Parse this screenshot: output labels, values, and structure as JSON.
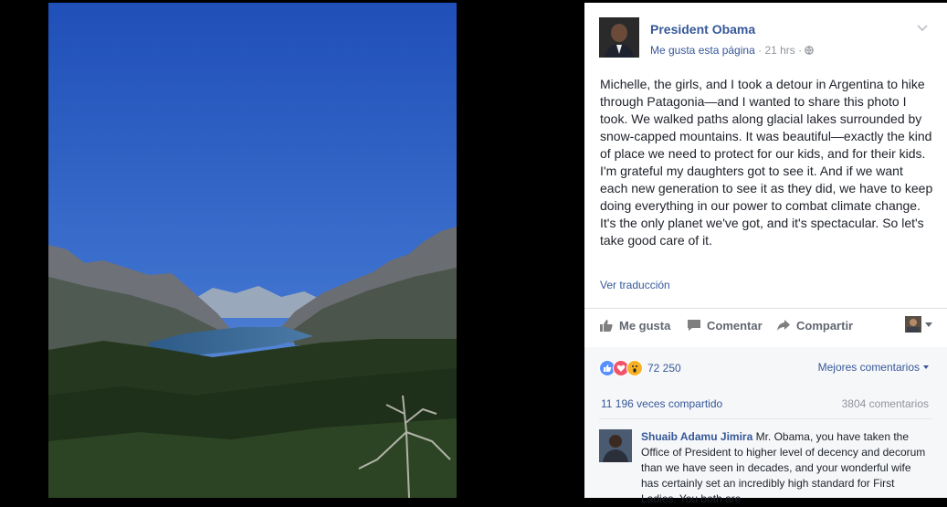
{
  "page": {
    "name": "President Obama",
    "like_page": "Me gusta esta página",
    "dot": "·",
    "time": "21 hrs",
    "dot2": "·"
  },
  "post": {
    "text": "Michelle, the girls, and I took a detour in Argentina to hike through Patagonia—and I wanted to share this photo I took. We walked paths along glacial lakes surrounded by snow-capped mountains. It was beautiful—exactly the kind of place we need to protect for our kids, and for their kids. I'm grateful my daughters got to see it. And if we want each new generation to see it as they did, we have to keep doing everything in our power to combat climate change. It's the only planet we've got, and it's spectacular. So let's take good care of it.",
    "see_translation": "Ver traducción"
  },
  "actions": {
    "like": "Me gusta",
    "comment": "Comentar",
    "share": "Compartir"
  },
  "stats": {
    "reaction_count": "72 250",
    "best_comments": "Mejores comentarios",
    "shares": "11 196 veces compartido",
    "comments": "3804 comentarios"
  },
  "comment": {
    "author": "Shuaib Adamu Jimira",
    "text": "Mr. Obama, you have taken the Office of President to higher level of decency and decorum than we have seen in decades, and your wonderful wife has certainly set an incredibly high standard for First Ladies. You both are"
  },
  "colors": {
    "link": "#365899",
    "muted": "#90949c",
    "sky": "#2e5fc0",
    "like_reaction": "#5890ff",
    "love_reaction": "#f25268",
    "wow_reaction": "#f7b125"
  }
}
